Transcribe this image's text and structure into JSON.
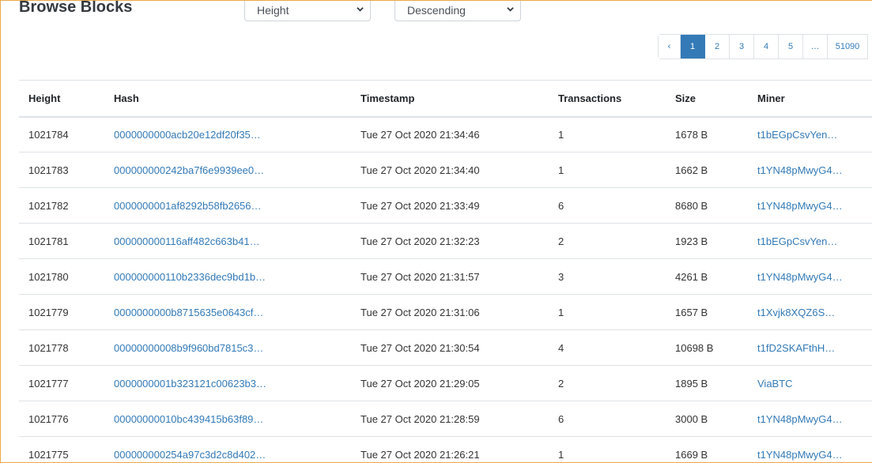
{
  "page": {
    "title": "Browse Blocks",
    "sort_field": "Height",
    "sort_order": "Descending"
  },
  "pagination": {
    "prev": "‹",
    "pages": [
      "1",
      "2",
      "3",
      "4",
      "5"
    ],
    "active": "1",
    "ellipsis": "…",
    "last": "51090"
  },
  "table": {
    "headers": [
      "Height",
      "Hash",
      "Timestamp",
      "Transactions",
      "Size",
      "Miner"
    ],
    "rows": [
      {
        "height": "1021784",
        "hash": "0000000000acb20e12df20f35…",
        "timestamp": "Tue 27 Oct 2020 21:34:46",
        "transactions": "1",
        "size": "1678 B",
        "miner": "t1bEGpCsvYen…"
      },
      {
        "height": "1021783",
        "hash": "000000000242ba7f6e9939ee0…",
        "timestamp": "Tue 27 Oct 2020 21:34:40",
        "transactions": "1",
        "size": "1662 B",
        "miner": "t1YN48pMwyG4…"
      },
      {
        "height": "1021782",
        "hash": "0000000001af8292b58fb2656…",
        "timestamp": "Tue 27 Oct 2020 21:33:49",
        "transactions": "6",
        "size": "8680 B",
        "miner": "t1YN48pMwyG4…"
      },
      {
        "height": "1021781",
        "hash": "000000000116aff482c663b41…",
        "timestamp": "Tue 27 Oct 2020 21:32:23",
        "transactions": "2",
        "size": "1923 B",
        "miner": "t1bEGpCsvYen…"
      },
      {
        "height": "1021780",
        "hash": "000000000110b2336dec9bd1b…",
        "timestamp": "Tue 27 Oct 2020 21:31:57",
        "transactions": "3",
        "size": "4261 B",
        "miner": "t1YN48pMwyG4…"
      },
      {
        "height": "1021779",
        "hash": "0000000000b8715635e0643cf…",
        "timestamp": "Tue 27 Oct 2020 21:31:06",
        "transactions": "1",
        "size": "1657 B",
        "miner": "t1Xvjk8XQZ6S…"
      },
      {
        "height": "1021778",
        "hash": "00000000008b9f960bd7815c3…",
        "timestamp": "Tue 27 Oct 2020 21:30:54",
        "transactions": "4",
        "size": "10698 B",
        "miner": "t1fD2SKAFthH…"
      },
      {
        "height": "1021777",
        "hash": "0000000001b323121c00623b3…",
        "timestamp": "Tue 27 Oct 2020 21:29:05",
        "transactions": "2",
        "size": "1895 B",
        "miner": "ViaBTC"
      },
      {
        "height": "1021776",
        "hash": "00000000010bc439415b63f89…",
        "timestamp": "Tue 27 Oct 2020 21:28:59",
        "transactions": "6",
        "size": "3000 B",
        "miner": "t1YN48pMwyG4…"
      },
      {
        "height": "1021775",
        "hash": "000000000254a97c3d2c8d402…",
        "timestamp": "Tue 27 Oct 2020 21:26:21",
        "transactions": "1",
        "size": "1669 B",
        "miner": "t1YN48pMwyG4…"
      }
    ]
  },
  "colors": {
    "link": "#337ab7",
    "active_page": "#337ab7",
    "frame_border": "#e8a94a"
  },
  "icons": {
    "select_chevron": "chevron-down-icon"
  }
}
